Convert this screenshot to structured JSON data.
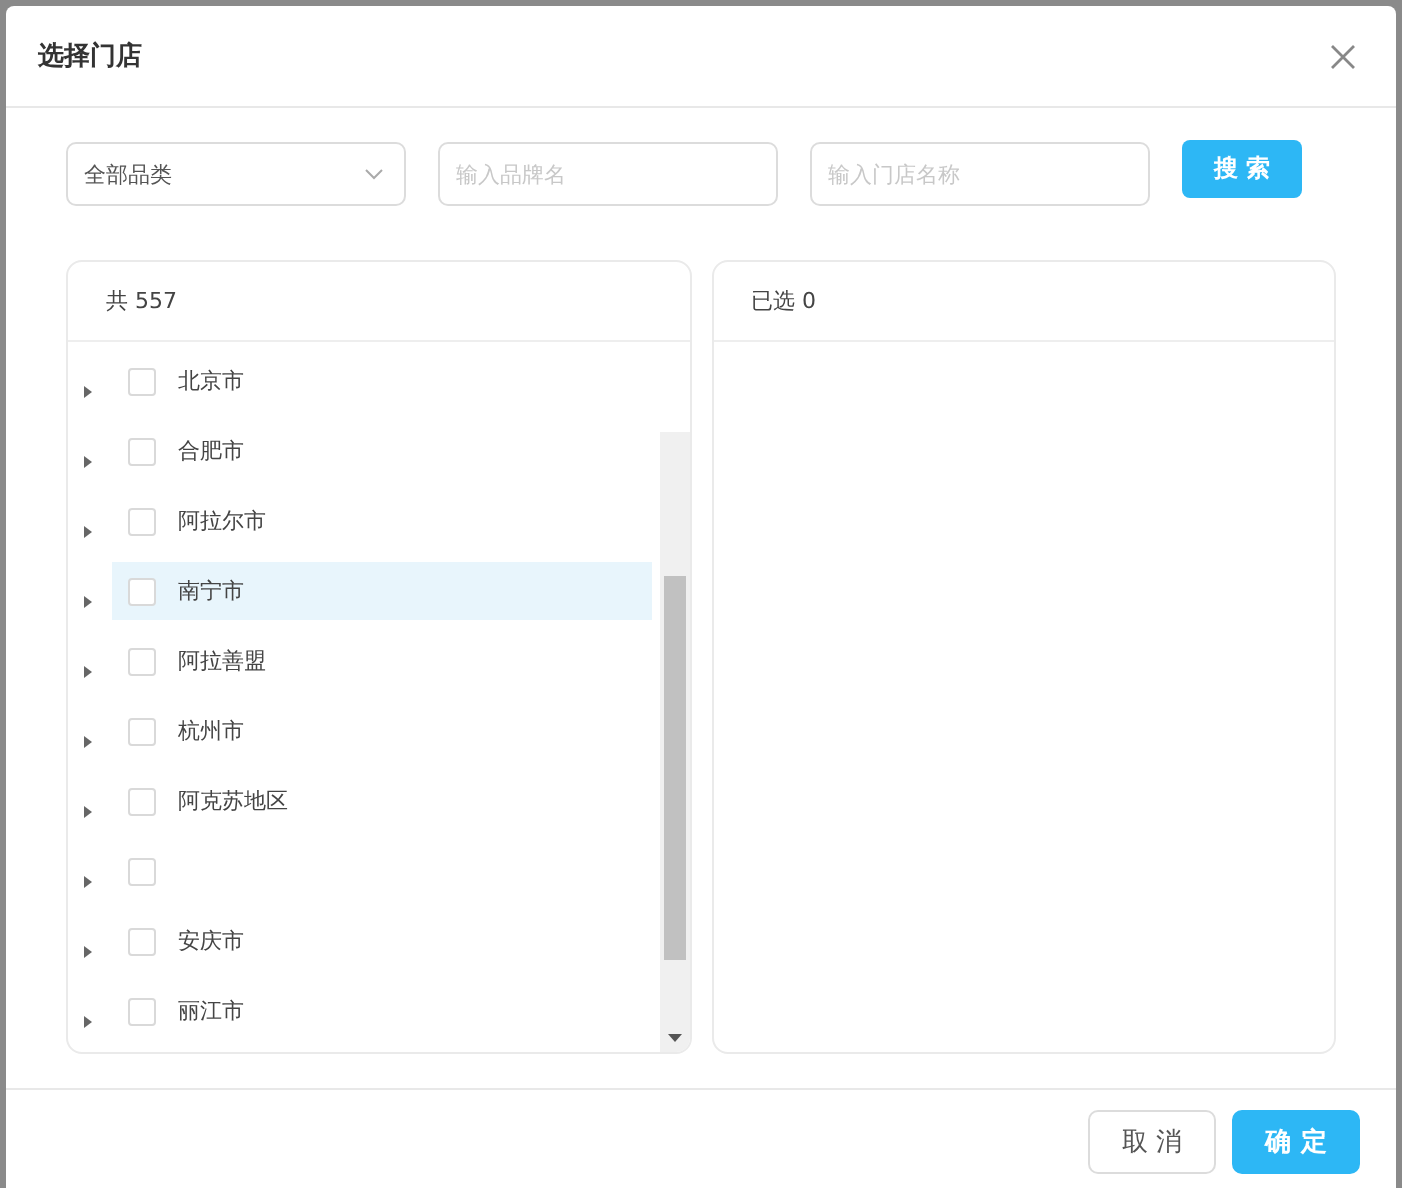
{
  "dialog": {
    "title": "选择门店"
  },
  "filters": {
    "category": {
      "value": "全部品类"
    },
    "brand": {
      "placeholder": "输入品牌名"
    },
    "store": {
      "placeholder": "输入门店名称"
    },
    "search_button": "搜 索"
  },
  "left_panel": {
    "header": "共 557",
    "items": [
      {
        "label": "北京市",
        "checked": false,
        "selected": false
      },
      {
        "label": "合肥市",
        "checked": false,
        "selected": false
      },
      {
        "label": "阿拉尔市",
        "checked": false,
        "selected": false
      },
      {
        "label": "南宁市",
        "checked": false,
        "selected": true
      },
      {
        "label": "阿拉善盟",
        "checked": false,
        "selected": false
      },
      {
        "label": "杭州市",
        "checked": false,
        "selected": false
      },
      {
        "label": "阿克苏地区",
        "checked": false,
        "selected": false
      },
      {
        "checked": false,
        "selected": false
      },
      {
        "label": "安庆市",
        "checked": false,
        "selected": false
      },
      {
        "label": "丽江市",
        "checked": false,
        "selected": false
      }
    ]
  },
  "right_panel": {
    "header": "已选 0"
  },
  "buttons": [
    {
      "label": "取 消",
      "kind": "secondary"
    },
    {
      "label": "确 定",
      "kind": "primary"
    }
  ]
}
